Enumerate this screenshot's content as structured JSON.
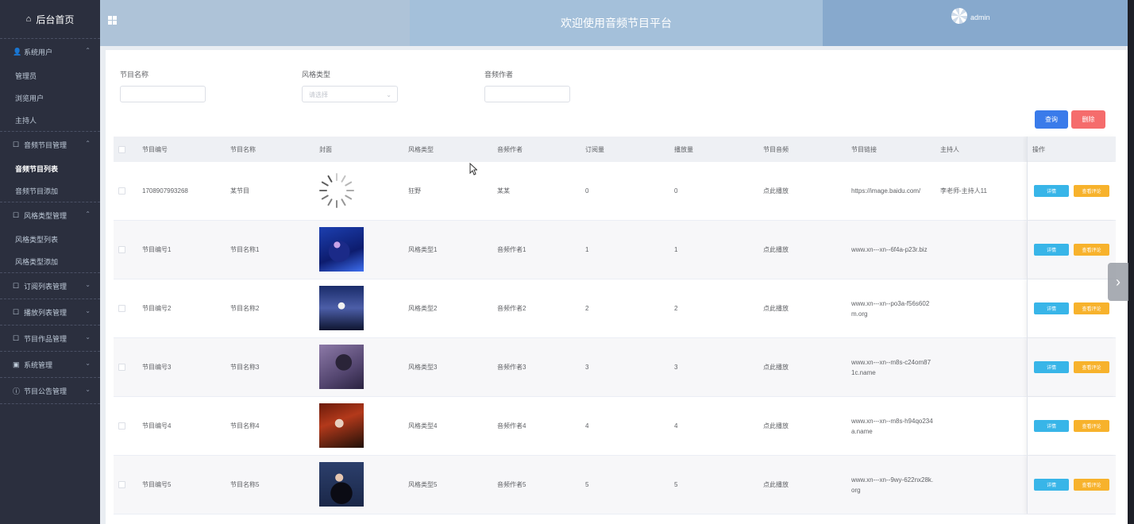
{
  "sidebar": {
    "home": "后台首页",
    "groups": [
      {
        "label": "系统用户",
        "icon": "user-icon",
        "items": [
          "管理员",
          "浏览用户",
          "主持人"
        ]
      },
      {
        "label": "音频节目管理",
        "icon": "edit-icon",
        "items": [
          "音频节目列表",
          "音频节目添加"
        ]
      },
      {
        "label": "风格类型管理",
        "icon": "edit-icon",
        "items": [
          "风格类型列表",
          "风格类型添加"
        ]
      },
      {
        "label": "订阅列表管理",
        "icon": "edit-icon",
        "items": []
      },
      {
        "label": "播放列表管理",
        "icon": "edit-icon",
        "items": []
      },
      {
        "label": "节目作品管理",
        "icon": "edit-icon",
        "items": []
      },
      {
        "label": "系统管理",
        "icon": "image-icon",
        "items": []
      },
      {
        "label": "节目公告管理",
        "icon": "info-icon",
        "items": []
      }
    ],
    "active_item": "音频节目列表"
  },
  "header": {
    "title": "欢迎使用音频节目平台",
    "username": "admin"
  },
  "filters": {
    "name_label": "节目名称",
    "name_value": "",
    "style_label": "风格类型",
    "style_placeholder": "请选择",
    "author_label": "音频作者",
    "author_value": ""
  },
  "buttons": {
    "query": "查询",
    "delete": "删除"
  },
  "colors": {
    "primary": "#3a7bea",
    "danger": "#f56c6c",
    "info": "#38b5e8",
    "warning": "#f7b22c",
    "sidebar": "#2b2f3e"
  },
  "table": {
    "headers": [
      "节目编号",
      "节目名称",
      "封面",
      "风格类型",
      "音频作者",
      "订阅量",
      "播放量",
      "节目音频",
      "节目链接",
      "主持人",
      "操作"
    ],
    "detail_label": "详情",
    "comment_label": "查看评论",
    "rows": [
      {
        "id": "1708907993268",
        "name": "某节目",
        "cover": "loading",
        "style": "狂野",
        "author": "某某",
        "subs": "0",
        "plays": "0",
        "audio": "点此播放",
        "link": "https://image.baidu.com/",
        "host": "李老师-主持人11"
      },
      {
        "id": "节目编号1",
        "name": "节目名称1",
        "cover": "singer-1",
        "style": "风格类型1",
        "author": "音频作者1",
        "subs": "1",
        "plays": "1",
        "audio": "点此播放",
        "link": "www.xn---xn--6f4a-p23r.biz",
        "host": ""
      },
      {
        "id": "节目编号2",
        "name": "节目名称2",
        "cover": "singer-2",
        "style": "风格类型2",
        "author": "音频作者2",
        "subs": "2",
        "plays": "2",
        "audio": "点此播放",
        "link": "www.xn---xn--po3a-f56s602m.org",
        "host": ""
      },
      {
        "id": "节目编号3",
        "name": "节目名称3",
        "cover": "singer-3",
        "style": "风格类型3",
        "author": "音频作者3",
        "subs": "3",
        "plays": "3",
        "audio": "点此播放",
        "link": "www.xn---xn--m8s-c24om871c.name",
        "host": ""
      },
      {
        "id": "节目编号4",
        "name": "节目名称4",
        "cover": "singer-4",
        "style": "风格类型4",
        "author": "音频作者4",
        "subs": "4",
        "plays": "4",
        "audio": "点此播放",
        "link": "www.xn---xn--m8s-h94qo234a.name",
        "host": ""
      },
      {
        "id": "节目编号5",
        "name": "节目名称5",
        "cover": "singer-5",
        "style": "风格类型5",
        "author": "音频作者5",
        "subs": "5",
        "plays": "5",
        "audio": "点此播放",
        "link": "www.xn---xn--9wy-622nx28k.org",
        "host": ""
      }
    ]
  }
}
